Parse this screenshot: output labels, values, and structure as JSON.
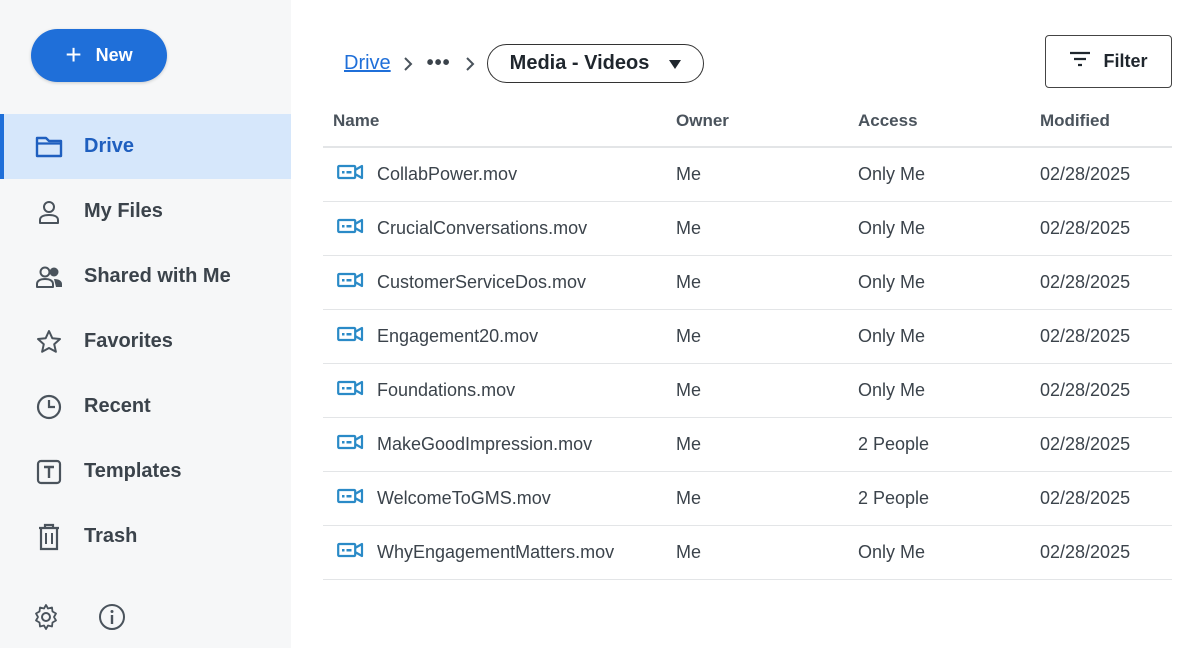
{
  "sidebar": {
    "new_label": "New",
    "items": [
      {
        "label": "Drive",
        "icon": "folder-icon",
        "active": true
      },
      {
        "label": "My Files",
        "icon": "person-icon"
      },
      {
        "label": "Shared with Me",
        "icon": "people-icon"
      },
      {
        "label": "Favorites",
        "icon": "star-icon"
      },
      {
        "label": "Recent",
        "icon": "clock-icon"
      },
      {
        "label": "Templates",
        "icon": "template-icon"
      },
      {
        "label": "Trash",
        "icon": "trash-icon"
      }
    ],
    "bottom_icons": [
      "gear-icon",
      "info-icon"
    ]
  },
  "breadcrumb": {
    "root": "Drive",
    "more": "•••",
    "current": "Media - Videos"
  },
  "filter_label": "Filter",
  "table": {
    "columns": [
      "Name",
      "Owner",
      "Access",
      "Modified"
    ],
    "rows": [
      {
        "name": "CollabPower.mov",
        "owner": "Me",
        "access": "Only Me",
        "modified": "02/28/2025"
      },
      {
        "name": "CrucialConversations.mov",
        "owner": "Me",
        "access": "Only Me",
        "modified": "02/28/2025"
      },
      {
        "name": "CustomerServiceDos.mov",
        "owner": "Me",
        "access": "Only Me",
        "modified": "02/28/2025"
      },
      {
        "name": "Engagement20.mov",
        "owner": "Me",
        "access": "Only Me",
        "modified": "02/28/2025"
      },
      {
        "name": "Foundations.mov",
        "owner": "Me",
        "access": "Only Me",
        "modified": "02/28/2025"
      },
      {
        "name": "MakeGoodImpression.mov",
        "owner": "Me",
        "access": "2 People",
        "modified": "02/28/2025"
      },
      {
        "name": "WelcomeToGMS.mov",
        "owner": "Me",
        "access": "2 People",
        "modified": "02/28/2025"
      },
      {
        "name": "WhyEngagementMatters.mov",
        "owner": "Me",
        "access": "Only Me",
        "modified": "02/28/2025"
      }
    ]
  },
  "colors": {
    "accent": "#1f6fd9",
    "active_bg": "#d6e7fb",
    "video_icon": "#2a8ac7",
    "sidebar_bg": "#f6f7f8"
  }
}
